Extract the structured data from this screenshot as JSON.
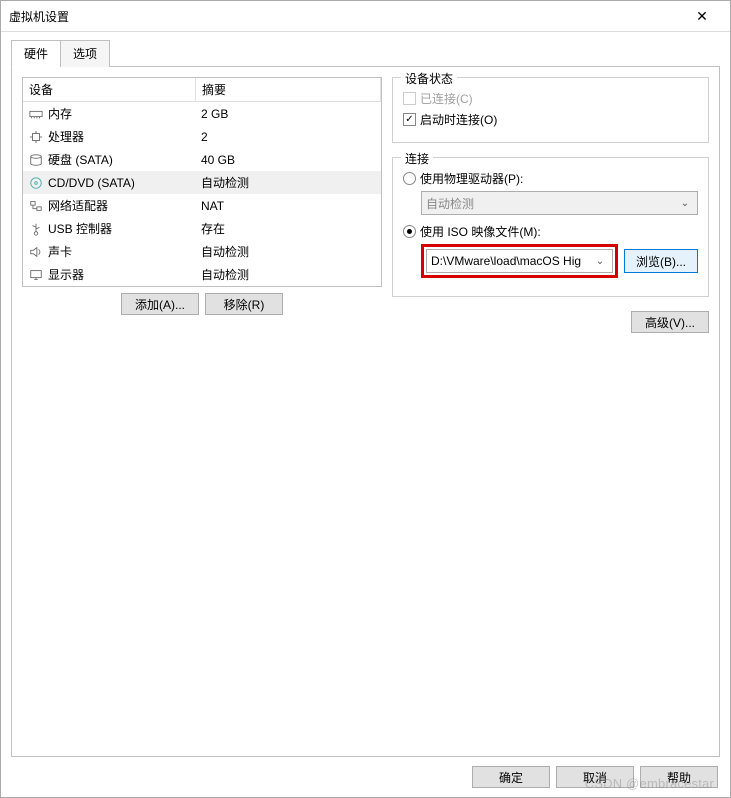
{
  "window": {
    "title": "虚拟机设置"
  },
  "tabs": {
    "hardware": "硬件",
    "options": "选项"
  },
  "list": {
    "header_device": "设备",
    "header_summary": "摘要",
    "rows": [
      {
        "icon": "memory-icon",
        "name": "内存",
        "summary": "2 GB"
      },
      {
        "icon": "cpu-icon",
        "name": "处理器",
        "summary": "2"
      },
      {
        "icon": "disk-icon",
        "name": "硬盘 (SATA)",
        "summary": "40 GB"
      },
      {
        "icon": "cd-icon",
        "name": "CD/DVD (SATA)",
        "summary": "自动检测"
      },
      {
        "icon": "network-icon",
        "name": "网络适配器",
        "summary": "NAT"
      },
      {
        "icon": "usb-icon",
        "name": "USB 控制器",
        "summary": "存在"
      },
      {
        "icon": "sound-icon",
        "name": "声卡",
        "summary": "自动检测"
      },
      {
        "icon": "display-icon",
        "name": "显示器",
        "summary": "自动检测"
      }
    ],
    "selected_index": 3,
    "add_btn": "添加(A)...",
    "remove_btn": "移除(R)"
  },
  "device_status": {
    "title": "设备状态",
    "connected": "已连接(C)",
    "connect_at_poweron": "启动时连接(O)"
  },
  "connection": {
    "title": "连接",
    "physical": "使用物理驱动器(P):",
    "physical_value": "自动检测",
    "iso": "使用 ISO 映像文件(M):",
    "iso_value": "D:\\VMware\\load\\macOS Hig",
    "browse": "浏览(B)...",
    "advanced": "高级(V)..."
  },
  "footer": {
    "ok": "确定",
    "cancel": "取消",
    "help": "帮助"
  },
  "watermark": "CSDN @embracestar"
}
